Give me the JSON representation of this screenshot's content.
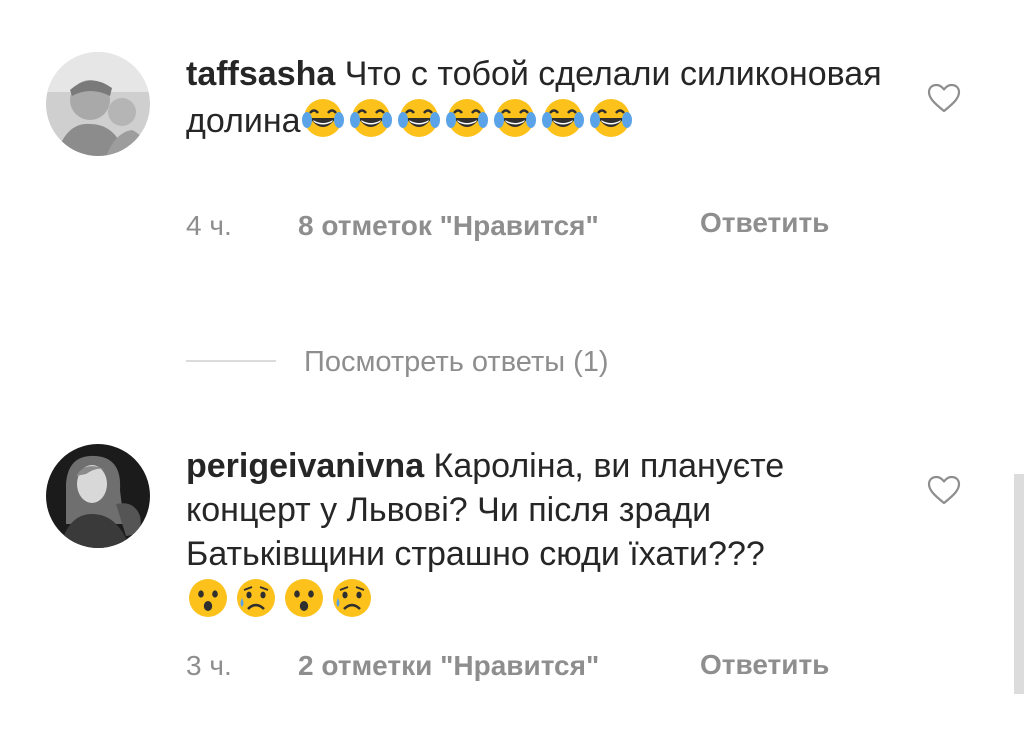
{
  "comments": [
    {
      "username": "taffsasha",
      "text": " Что с тобой сделали силиконовая долина",
      "emoji": [
        "face-with-tears-of-joy",
        "face-with-tears-of-joy",
        "face-with-tears-of-joy",
        "face-with-tears-of-joy",
        "face-with-tears-of-joy",
        "face-with-tears-of-joy",
        "face-with-tears-of-joy"
      ],
      "time": "4 ч.",
      "likes": "8 отметок \"Нравится\"",
      "reply_label": "Ответить"
    },
    {
      "username": "perigeivanivna",
      "text": " Кароліна, ви плануєте концерт у Львові? Чи після зради Батьківщини страшно сюди їхати???",
      "emoji": [
        "hushed-face",
        "sad-but-relieved-face",
        "hushed-face",
        "sad-but-relieved-face"
      ],
      "time": "3 ч.",
      "likes": "2 отметки \"Нравится\"",
      "reply_label": "Ответить"
    }
  ],
  "view_replies": "Посмотреть ответы (1)",
  "colors": {
    "text": "#262626",
    "secondary": "#8e8e8e",
    "divider": "#dbdbdb",
    "emoji_yellow": "#fcc21b"
  }
}
